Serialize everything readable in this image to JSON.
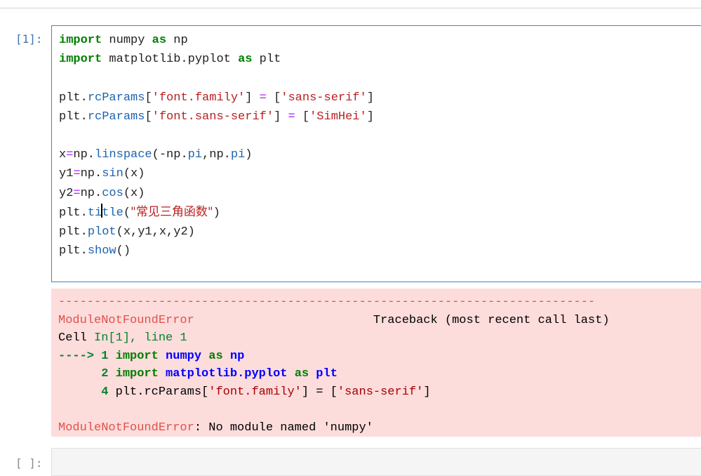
{
  "cells": [
    {
      "prompt": "[1]:",
      "code_lines": [
        {
          "kw1": "import",
          "t1": " numpy ",
          "kw2": "as",
          "t2": " np"
        },
        {
          "kw1": "import",
          "t1": " matplotlib.pyplot ",
          "kw2": "as",
          "t2": " plt"
        },
        {
          "obj": "plt.",
          "attr": "rcParams",
          "b1": "[",
          "key": "'font.family'",
          "b2": "] ",
          "eq": "=",
          "b3": " [",
          "val": "'sans-serif'",
          "b4": "]"
        },
        {
          "obj": "plt.",
          "attr": "rcParams",
          "b1": "[",
          "key": "'font.sans-serif'",
          "b2": "] ",
          "eq": "=",
          "b3": " [",
          "val": "'SimHei'",
          "b4": "]"
        },
        {
          "a": "x",
          "eq": "=",
          "b": "np.",
          "attr": "linspace",
          "c": "(-np.",
          "attr2": "pi",
          "d": ",np.",
          "attr3": "pi",
          "e": ")"
        },
        {
          "a": "y1",
          "eq": "=",
          "b": "np.",
          "attr": "sin",
          "c": "(x)"
        },
        {
          "a": "y2",
          "eq": "=",
          "b": "np.",
          "attr": "cos",
          "c": "(x)"
        },
        {
          "obj": "plt.",
          "attr_a": "ti",
          "attr_b": "tle",
          "open": "(",
          "str": "\"常见三角函数\"",
          "close": ")"
        },
        {
          "obj": "plt.",
          "attr": "plot",
          "rest": "(x,y1,x,y2)"
        },
        {
          "obj": "plt.",
          "attr": "show",
          "rest": "()"
        }
      ],
      "output": {
        "dashes": "---------------------------------------------------------------------------",
        "error_name": "ModuleNotFoundError",
        "traceback_header": "                         Traceback (most recent call last)",
        "cell_prefix": "Cell ",
        "cell_ref": "In[1], line 1",
        "arrow": "----> 1 ",
        "line1_kw": "import",
        "line1_mod": "numpy",
        "line1_as": "as",
        "line1_alias": "np",
        "line2_num": "      2 ",
        "line2_kw": "import",
        "line2_mod": "matplotlib.pyplot",
        "line2_as": "as",
        "line2_alias": "plt",
        "line4_num": "      4 ",
        "line4_a": "plt.rcParams[",
        "line4_key": "'font.family'",
        "line4_b": "] = [",
        "line4_val": "'sans-serif'",
        "line4_c": "]",
        "final_error": "ModuleNotFoundError",
        "final_msg": ": No module named 'numpy'"
      }
    },
    {
      "prompt": "[ ]:"
    }
  ],
  "colors": {
    "editor_border": "#3f86c8",
    "prompt": "#3f75b0",
    "error_bg": "#fddcdc",
    "error_red": "#e0524a"
  }
}
